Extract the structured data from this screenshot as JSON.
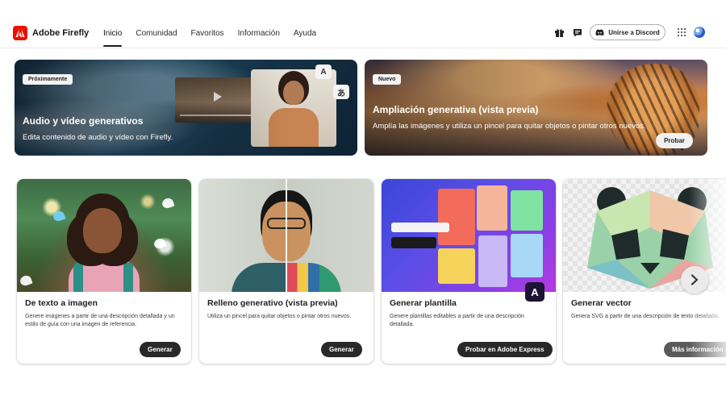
{
  "app": {
    "name": "Adobe Firefly",
    "brand_color": "#eb1000"
  },
  "nav": {
    "items": [
      {
        "label": "Inicio",
        "active": true
      },
      {
        "label": "Comunidad",
        "active": false
      },
      {
        "label": "Favoritos",
        "active": false
      },
      {
        "label": "Información",
        "active": false
      },
      {
        "label": "Ayuda",
        "active": false
      }
    ]
  },
  "header": {
    "icons": [
      "gift-icon",
      "feedback-icon",
      "apps-grid-icon",
      "avatar"
    ],
    "discord_label": "Unirse a Discord"
  },
  "banners": [
    {
      "badge": "Próximamente",
      "title": "Audio y vídeo generativos",
      "description": "Edita contenido de audio y vídeo con Firefly.",
      "chips": [
        "A",
        "あ"
      ]
    },
    {
      "badge": "Nuevo",
      "title": "Ampliación generativa (vista previa)",
      "description": "Amplía las imágenes y utiliza un pincel para quitar objetos o pintar otros nuevos.",
      "button": "Probar"
    }
  ],
  "cards": [
    {
      "title": "De texto a imagen",
      "description": "Genere imágenes a partir de una descripción detallada y un estilo de guía con una imagen de referencia.",
      "button": "Generar"
    },
    {
      "title": "Relleno generativo (vista previa)",
      "description": "Utiliza un pincel para quitar objetos o pintar otros nuevos.",
      "button": "Generar"
    },
    {
      "title": "Generar plantilla",
      "description": "Genere plantillas editables a partir de una descripción detallada.",
      "button": "Probar en Adobe Express"
    },
    {
      "title": "Generar vector",
      "description": "Genera SVG a partir de una descripción de texto detallada.",
      "button": "Más información"
    }
  ],
  "carousel": {
    "next_icon": "chevron-right-icon"
  }
}
